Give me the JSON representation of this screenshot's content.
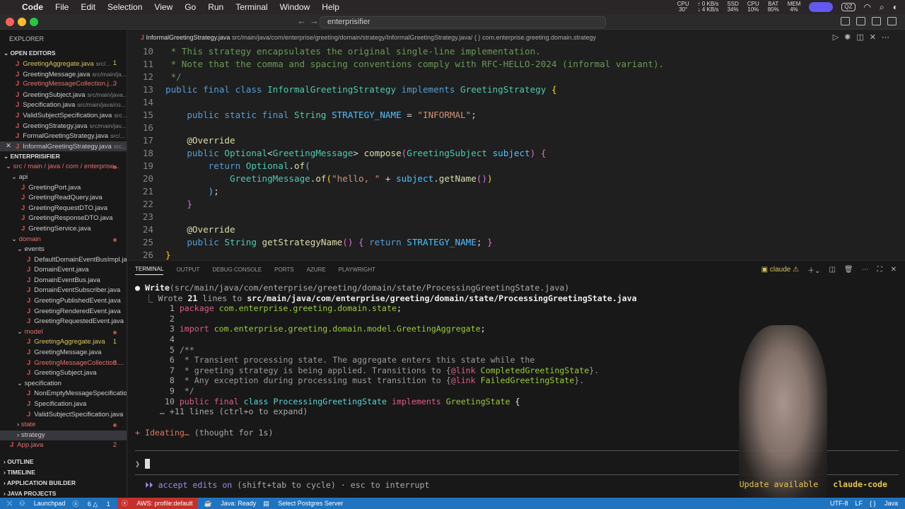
{
  "menubar": {
    "app": "Code",
    "items": [
      "File",
      "Edit",
      "Selection",
      "View",
      "Go",
      "Run",
      "Terminal",
      "Window",
      "Help"
    ],
    "stats": [
      {
        "label": "CPU",
        "value": "30°"
      },
      {
        "label": "↑ 0 KB/s",
        "value": "↓ 4 KB/s"
      },
      {
        "label": "SSD",
        "value": "34%"
      },
      {
        "label": "CPU",
        "value": "10%"
      },
      {
        "label": "BAT",
        "value": "80%"
      },
      {
        "label": "MEM",
        "value": "4%"
      }
    ],
    "qz": "QZ"
  },
  "title": {
    "search": "enterprisifier"
  },
  "explorer": {
    "title": "EXPLORER",
    "open_editors_label": "OPEN EDITORS",
    "open_editors": [
      {
        "name": "GreetingAggregate.java",
        "desc": "src/...",
        "badge": "1",
        "state": "warn"
      },
      {
        "name": "GreetingMessage.java",
        "desc": "src/main/ja...",
        "state": "normal"
      },
      {
        "name": "GreetingMessageCollection.j...",
        "badge": "3",
        "state": "error"
      },
      {
        "name": "GreetingSubject.java",
        "desc": "src/main/java...",
        "state": "normal"
      },
      {
        "name": "Specification.java",
        "desc": "src/main/java/co...",
        "state": "normal"
      },
      {
        "name": "ValidSubjectSpecification.java",
        "desc": "src...",
        "state": "normal"
      },
      {
        "name": "GreetingStrategy.java",
        "desc": "src/main/jav...",
        "state": "normal"
      },
      {
        "name": "FormalGreetingStrategy.java",
        "desc": "src/...",
        "state": "normal"
      },
      {
        "name": "InformalGreetingStrategy.java",
        "desc": "src...",
        "state": "active"
      }
    ],
    "project_label": "ENTERPRISIFIER",
    "tree": [
      {
        "name": "src / main / java / com / enterprise...",
        "indent": 1,
        "type": "folder",
        "state": "error",
        "dot": true
      },
      {
        "name": "api",
        "indent": 2,
        "type": "folder"
      },
      {
        "name": "GreetingPort.java",
        "indent": 3,
        "type": "file"
      },
      {
        "name": "GreetingReadQuery.java",
        "indent": 3,
        "type": "file"
      },
      {
        "name": "GreetingRequestDTO.java",
        "indent": 3,
        "type": "file"
      },
      {
        "name": "GreetingResponseDTO.java",
        "indent": 3,
        "type": "file"
      },
      {
        "name": "GreetingService.java",
        "indent": 3,
        "type": "file"
      },
      {
        "name": "domain",
        "indent": 2,
        "type": "folder",
        "state": "error",
        "dot": true
      },
      {
        "name": "events",
        "indent": 3,
        "type": "folder"
      },
      {
        "name": "DefaultDomainEventBusImpl.java",
        "indent": 4,
        "type": "file"
      },
      {
        "name": "DomainEvent.java",
        "indent": 4,
        "type": "file"
      },
      {
        "name": "DomainEventBus.java",
        "indent": 4,
        "type": "file"
      },
      {
        "name": "DomainEventSubscriber.java",
        "indent": 4,
        "type": "file"
      },
      {
        "name": "GreetingPublishedEvent.java",
        "indent": 4,
        "type": "file"
      },
      {
        "name": "GreetingRenderedEvent.java",
        "indent": 4,
        "type": "file"
      },
      {
        "name": "GreetingRequestedEvent.java",
        "indent": 4,
        "type": "file"
      },
      {
        "name": "model",
        "indent": 3,
        "type": "folder",
        "state": "error",
        "dot": true
      },
      {
        "name": "GreetingAggregate.java",
        "indent": 4,
        "type": "file",
        "state": "warn",
        "badge": "1"
      },
      {
        "name": "GreetingMessage.java",
        "indent": 4,
        "type": "file"
      },
      {
        "name": "GreetingMessageCollection....",
        "indent": 4,
        "type": "file",
        "state": "error",
        "badge": "3"
      },
      {
        "name": "GreetingSubject.java",
        "indent": 4,
        "type": "file"
      },
      {
        "name": "specification",
        "indent": 3,
        "type": "folder"
      },
      {
        "name": "NonEmptyMessageSpecification....",
        "indent": 4,
        "type": "file"
      },
      {
        "name": "Specification.java",
        "indent": 4,
        "type": "file"
      },
      {
        "name": "ValidSubjectSpecification.java",
        "indent": 4,
        "type": "file"
      },
      {
        "name": "state",
        "indent": 3,
        "type": "folder-closed",
        "state": "error",
        "dot": true
      },
      {
        "name": "strategy",
        "indent": 3,
        "type": "folder-closed",
        "selected": true
      },
      {
        "name": "App.java",
        "indent": 1,
        "type": "file",
        "state": "error",
        "badge": "2"
      }
    ],
    "sections": [
      "OUTLINE",
      "TIMELINE",
      "APPLICATION BUILDER",
      "JAVA PROJECTS"
    ]
  },
  "editor": {
    "file": "InformalGreetingStrategy.java",
    "path": "src/main/java/com/enterprise/greeting/domain/strategy/InformalGreetingStrategy.java/ { } com.enterprise.greeting.domain.strategy",
    "lines": [
      {
        "n": "10",
        "t": [
          [
            "cm",
            " * This strategy encapsulates the original single-line implementation."
          ]
        ]
      },
      {
        "n": "11",
        "t": [
          [
            "cm",
            " * Note that the comma and spacing conventions comply with RFC-HELLO-2024 (informal variant)."
          ]
        ]
      },
      {
        "n": "12",
        "t": [
          [
            "cm",
            " */"
          ]
        ]
      },
      {
        "n": "13",
        "t": [
          [
            "kw",
            "public final class "
          ],
          [
            "ty",
            "InformalGreetingStrategy "
          ],
          [
            "kw",
            "implements "
          ],
          [
            "ty",
            "GreetingStrategy "
          ],
          [
            "br",
            "{"
          ]
        ]
      },
      {
        "n": "14",
        "t": []
      },
      {
        "n": "15",
        "t": [
          [
            "pl",
            "    "
          ],
          [
            "kw",
            "public static final "
          ],
          [
            "ty",
            "String "
          ],
          [
            "cn",
            "STRATEGY_NAME"
          ],
          [
            "pl",
            " = "
          ],
          [
            "str",
            "\"INFORMAL\""
          ],
          [
            "pl",
            ";"
          ]
        ]
      },
      {
        "n": "16",
        "t": []
      },
      {
        "n": "17",
        "t": [
          [
            "pl",
            "    "
          ],
          [
            "an",
            "@Override"
          ]
        ]
      },
      {
        "n": "18",
        "t": [
          [
            "pl",
            "    "
          ],
          [
            "kw",
            "public "
          ],
          [
            "ty",
            "Optional"
          ],
          [
            "pl",
            "<"
          ],
          [
            "ty",
            "GreetingMessage"
          ],
          [
            "pl",
            "> "
          ],
          [
            "fn",
            "compose"
          ],
          [
            "br2",
            "("
          ],
          [
            "ty",
            "GreetingSubject "
          ],
          [
            "cn",
            "subject"
          ],
          [
            "br2",
            ")"
          ],
          [
            "pl",
            " "
          ],
          [
            "br2",
            "{"
          ]
        ]
      },
      {
        "n": "19",
        "t": [
          [
            "pl",
            "        "
          ],
          [
            "kw",
            "return "
          ],
          [
            "ty",
            "Optional"
          ],
          [
            "pl",
            "."
          ],
          [
            "fn",
            "of"
          ],
          [
            "cn",
            "("
          ]
        ]
      },
      {
        "n": "20",
        "t": [
          [
            "pl",
            "            "
          ],
          [
            "ty",
            "GreetingMessage"
          ],
          [
            "pl",
            "."
          ],
          [
            "fn",
            "of"
          ],
          [
            "br",
            "("
          ],
          [
            "str",
            "\"hello, \""
          ],
          [
            "pl",
            " + "
          ],
          [
            "cn",
            "subject"
          ],
          [
            "pl",
            "."
          ],
          [
            "fn",
            "getName"
          ],
          [
            "br2",
            "()"
          ],
          [
            "br",
            ")"
          ]
        ]
      },
      {
        "n": "21",
        "t": [
          [
            "pl",
            "        "
          ],
          [
            "cn",
            ")"
          ],
          [
            "pl",
            ";"
          ]
        ]
      },
      {
        "n": "22",
        "t": [
          [
            "pl",
            "    "
          ],
          [
            "br2",
            "}"
          ]
        ]
      },
      {
        "n": "23",
        "t": []
      },
      {
        "n": "24",
        "t": [
          [
            "pl",
            "    "
          ],
          [
            "an",
            "@Override"
          ]
        ]
      },
      {
        "n": "25",
        "t": [
          [
            "pl",
            "    "
          ],
          [
            "kw",
            "public "
          ],
          [
            "ty",
            "String "
          ],
          [
            "fn",
            "getStrategyName"
          ],
          [
            "br2",
            "()"
          ],
          [
            "pl",
            " "
          ],
          [
            "br2",
            "{"
          ],
          [
            "kw",
            " return "
          ],
          [
            "cn",
            "STRATEGY_NAME"
          ],
          [
            "pl",
            "; "
          ],
          [
            "br2",
            "}"
          ]
        ]
      },
      {
        "n": "26",
        "t": [
          [
            "br",
            "}"
          ]
        ]
      }
    ]
  },
  "panel": {
    "tabs": [
      "TERMINAL",
      "OUTPUT",
      "DEBUG CONSOLE",
      "PORTS",
      "AZURE",
      "PLAYWRIGHT"
    ],
    "terminal_name": "claude"
  },
  "terminal": {
    "lines": [
      [
        [
          "w",
          "● "
        ],
        [
          "b",
          "Write"
        ],
        [
          "g",
          "(src/main/java/com/enterprise/greeting/domain/state/ProcessingGreetingState.java)"
        ]
      ],
      [
        [
          "g",
          "  ⎿ Wrote "
        ],
        [
          "b",
          "21"
        ],
        [
          "g",
          " lines to "
        ],
        [
          "b",
          "src/main/java/com/enterprise/greeting/domain/state/ProcessingGreetingState.java"
        ]
      ],
      [
        [
          "g",
          "       1 "
        ],
        [
          "pk",
          "package "
        ],
        [
          "gr",
          "com.enterprise.greeting.domain.state"
        ],
        [
          "w",
          ";"
        ]
      ],
      [
        [
          "g",
          "       2"
        ]
      ],
      [
        [
          "g",
          "       3 "
        ],
        [
          "pk",
          "import "
        ],
        [
          "gr",
          "com.enterprise.greeting.domain.model.GreetingAggregate"
        ],
        [
          "w",
          ";"
        ]
      ],
      [
        [
          "g",
          "       4"
        ]
      ],
      [
        [
          "g",
          "       5 "
        ],
        [
          "cm",
          "/**"
        ]
      ],
      [
        [
          "g",
          "       6 "
        ],
        [
          "cm",
          " * Transient processing state. The aggregate enters this state while the"
        ]
      ],
      [
        [
          "g",
          "       7 "
        ],
        [
          "cm",
          " * greeting strategy is being applied. Transitions to {"
        ],
        [
          "pk",
          "@link "
        ],
        [
          "gr",
          "CompletedGreetingState"
        ],
        [
          "cm",
          "}."
        ]
      ],
      [
        [
          "g",
          "       8 "
        ],
        [
          "cm",
          " * Any exception during processing must transition to {"
        ],
        [
          "pk",
          "@link "
        ],
        [
          "gr",
          "FailedGreetingState"
        ],
        [
          "cm",
          "}."
        ]
      ],
      [
        [
          "g",
          "       9 "
        ],
        [
          "cm",
          " */"
        ]
      ],
      [
        [
          "g",
          "      10 "
        ],
        [
          "pk",
          "public final "
        ],
        [
          "cy",
          "class ProcessingGreetingState "
        ],
        [
          "pk",
          "implements "
        ],
        [
          "gr",
          "GreetingState "
        ],
        [
          "w",
          "{"
        ]
      ],
      [
        [
          "g",
          "     … +11 lines (ctrl+o to expand)"
        ]
      ]
    ],
    "status": [
      [
        "or",
        "+ Ideating… "
      ],
      [
        "g",
        "(thought for 1s)"
      ]
    ],
    "prompt": "❯",
    "mode": [
      [
        "pu",
        "⏵⏵ accept edits on "
      ],
      [
        "g",
        "(shift+tab to cycle) · esc to interrupt"
      ]
    ],
    "update": "Update available",
    "update_pkg": "claude-code"
  },
  "statusbar": {
    "launchpad": "Launchpad",
    "errors": "6",
    "warnings": "1",
    "aws": "AWS: profile:default",
    "java": "Java: Ready",
    "postgres": "Select Postgres Server",
    "encoding": "UTF-8",
    "eol": "LF",
    "lang": "Java"
  }
}
